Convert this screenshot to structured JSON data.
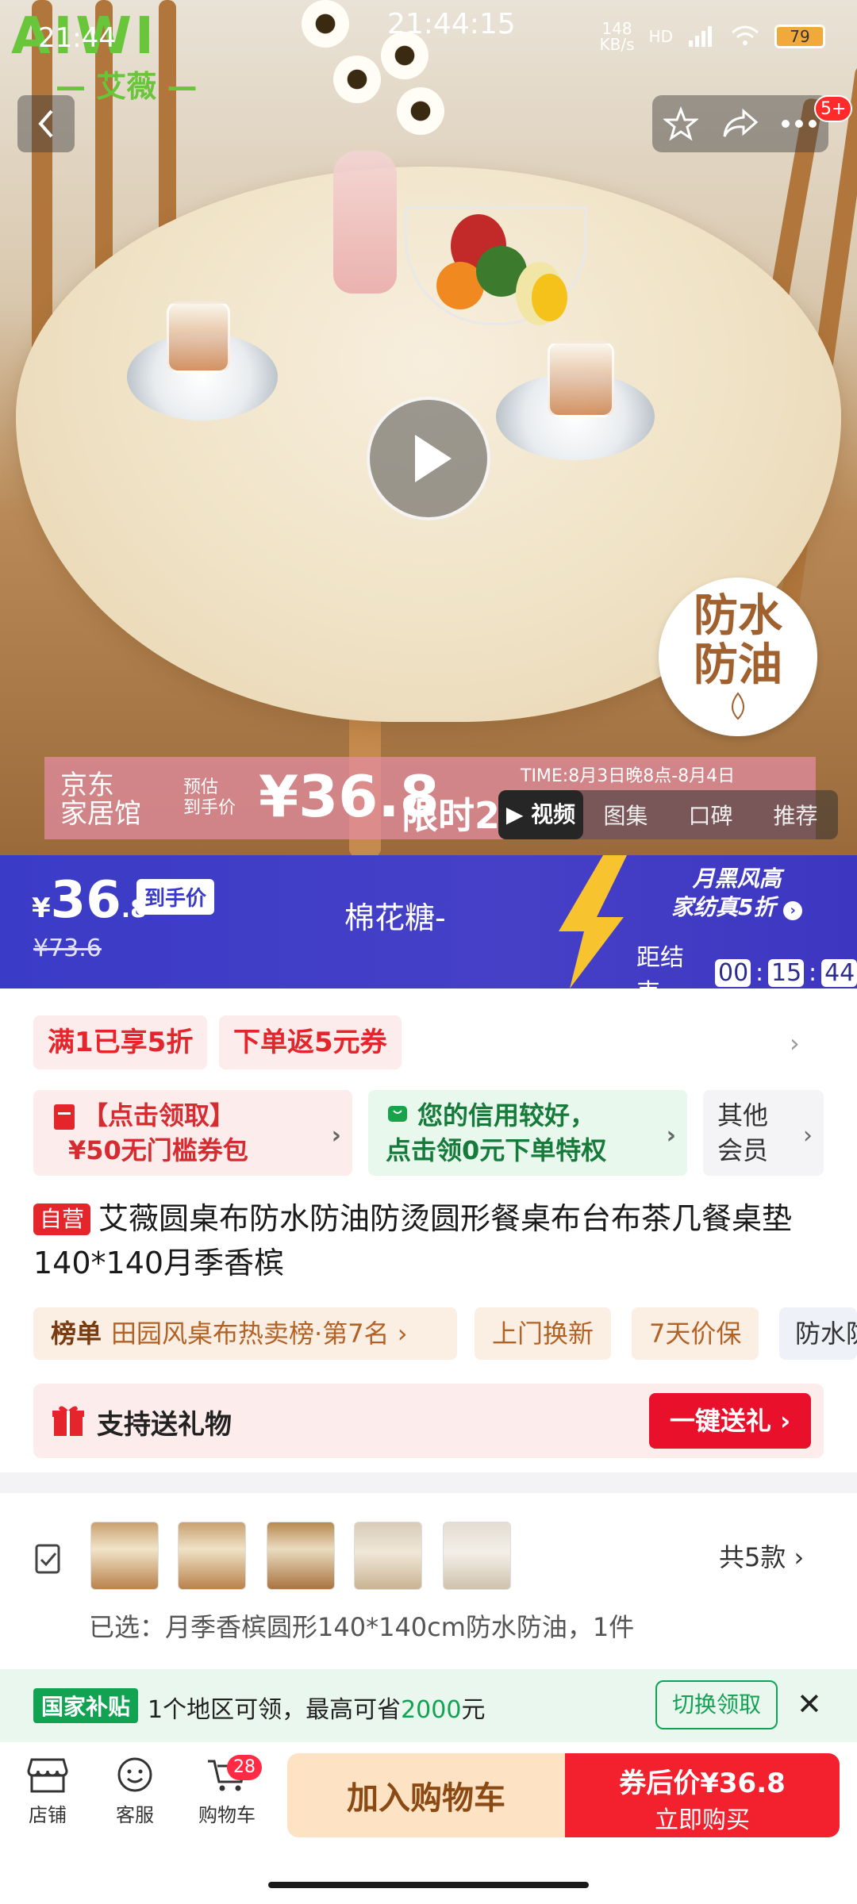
{
  "status_bar": {
    "time_left": "21:44",
    "time_center": "21:44:15",
    "net_speed": "148\nKB/s",
    "network": "HD",
    "battery": "79"
  },
  "brand": {
    "logo_text": "AIWI",
    "logo_sub": "— 艾薇 —"
  },
  "header": {
    "message_badge": "5+"
  },
  "hero": {
    "badge_line1": "防水",
    "badge_line2": "防油",
    "promo_shop": "京东\n家居馆",
    "promo_pre": "预估\n到手价",
    "promo_price": "¥36.8",
    "promo_flash": "限时2",
    "promo_time": "TIME:8月3日晚8点-8月4日",
    "media_tabs": [
      "▶ 视频",
      "图集",
      "口碑",
      "推荐"
    ]
  },
  "price_band": {
    "currency": "¥",
    "price_int": "36",
    "price_dec": ".8",
    "price_tag": "到手价",
    "old_price": "¥73.6",
    "seller": "棉花糖-",
    "campaign_line1": "月黑风高",
    "campaign_line2": "家纺真5折",
    "countdown_label": "距结束",
    "countdown": [
      "00",
      "15",
      "44"
    ]
  },
  "promos": {
    "chip1": "满1已享5折",
    "chip2": "下单返5元券"
  },
  "offers": {
    "coupon_line1": "【点击领取】",
    "coupon_line2": "¥50无门槛券包",
    "credit_line1": "您的信用较好，",
    "credit_line2": "点击领0元下单特权",
    "member_line1": "其他",
    "member_line2": "会员"
  },
  "product": {
    "self_operated": "自营",
    "title": "艾薇圆桌布防水防油防烫圆形餐桌布台布茶几餐桌垫140*140月季香槟"
  },
  "tags": {
    "rank_label": "榜单",
    "rank_text": "田园风桌布热卖榜·第7名 ›",
    "home": "上门换新",
    "price_protect": "7天价保",
    "water": "防水防"
  },
  "gift": {
    "label": "支持送礼物",
    "button": "一键送礼 ›"
  },
  "variant": {
    "count": "共5款  ›",
    "selected": "已选：月季香槟圆形140*140cm防水防油，1件"
  },
  "subsidy": {
    "badge": "国家补贴",
    "text_pre": "1个地区可领，最高可省",
    "amount": "2000",
    "text_post": "元",
    "button": "切换领取"
  },
  "bottom_bar": {
    "shop": "店铺",
    "service": "客服",
    "cart": "购物车",
    "cart_count": "28",
    "add_cart": "加入购物车",
    "buy_line1": "券后价¥36.8",
    "buy_line2": "立即购买"
  }
}
